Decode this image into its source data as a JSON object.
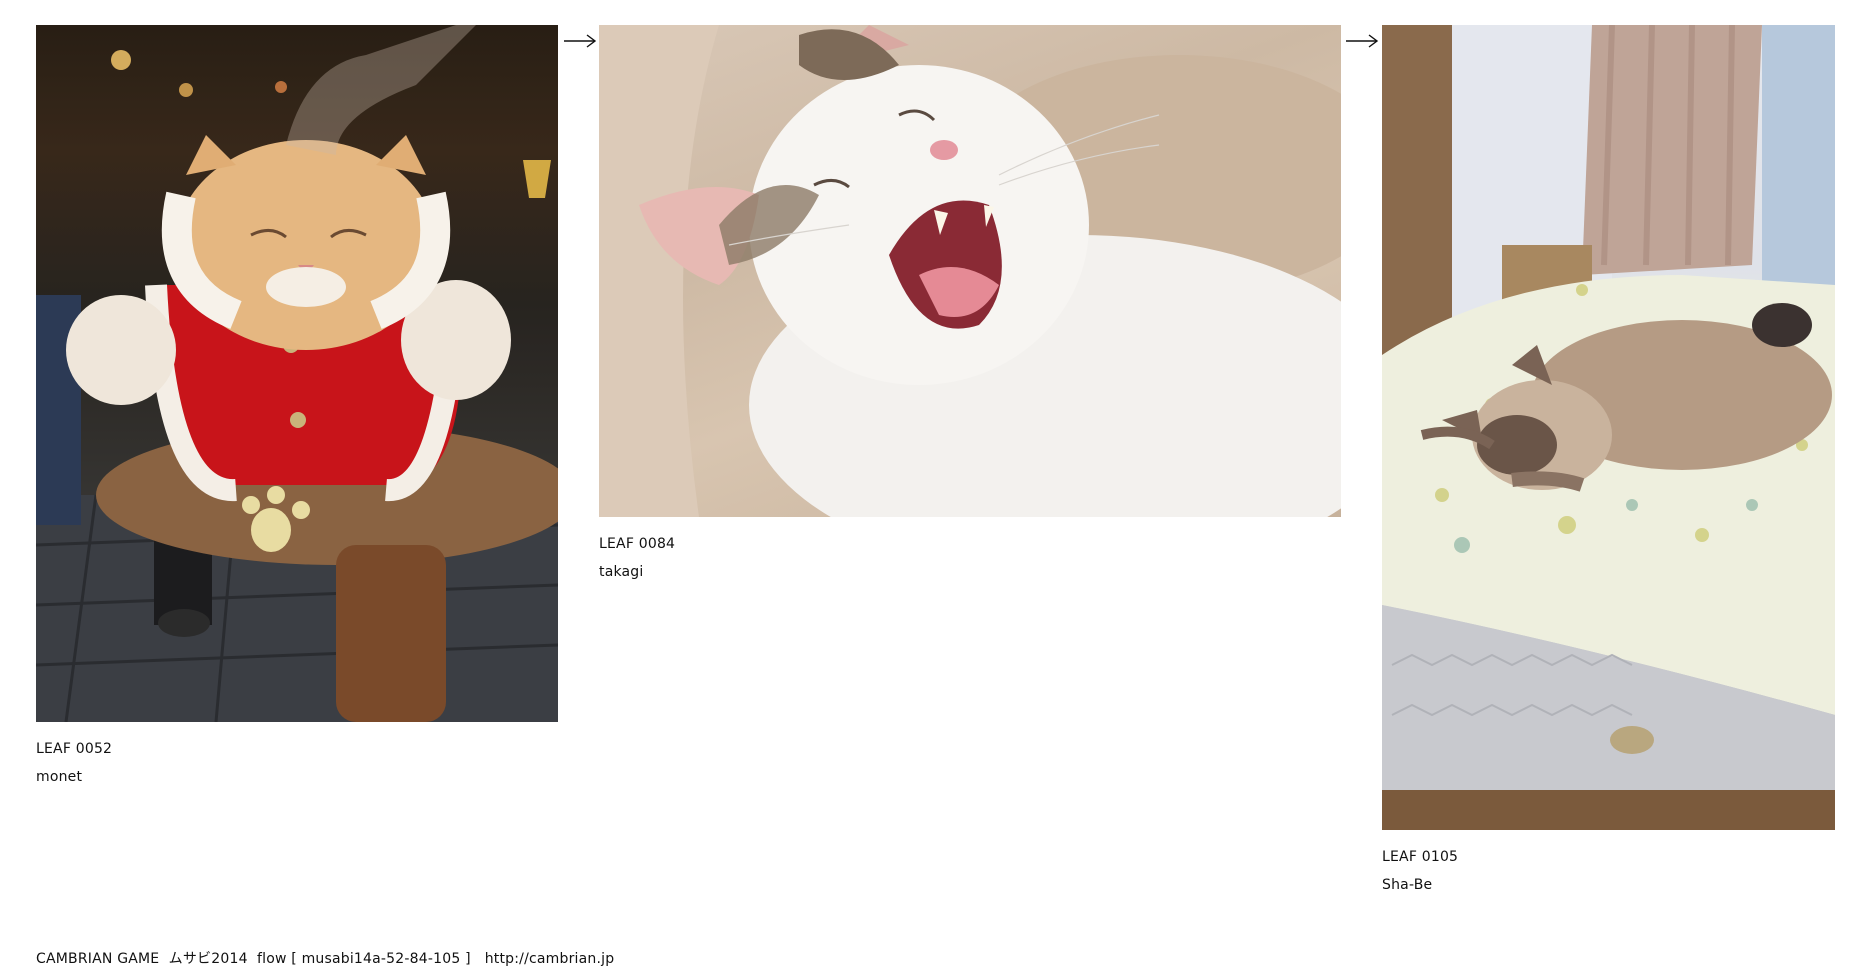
{
  "leaves": [
    {
      "code": "LEAF 0052",
      "author": "monet",
      "photo_icon": "cat-in-santa-costume-photo"
    },
    {
      "code": "LEAF 0084",
      "author": "takagi",
      "photo_icon": "yawning-white-cat-photo"
    },
    {
      "code": "LEAF 0105",
      "author": "Sha-Be",
      "photo_icon": "sleeping-siamese-cat-photo"
    }
  ],
  "arrow_icon": "right-arrow-icon",
  "footer": {
    "text": "CAMBRIAN GAME  ムサビ2014  flow [ musabi14a-52-84-105 ]   http://cambrian.jp"
  }
}
